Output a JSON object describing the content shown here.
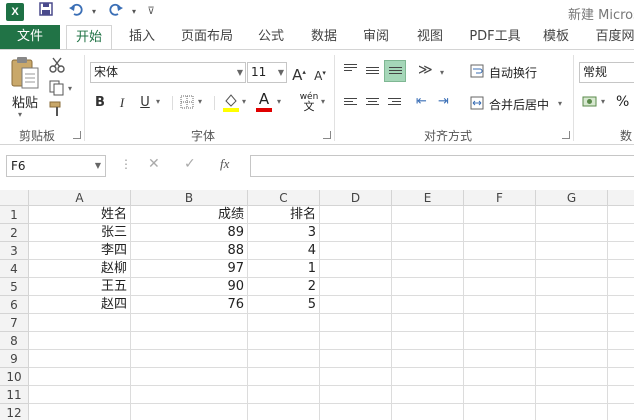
{
  "titlebar": {
    "app_icon": "X",
    "title": "新建 Micros",
    "quick_access": [
      "save-icon",
      "undo-icon",
      "redo-icon",
      "customize-icon"
    ]
  },
  "tabs": [
    {
      "label": "文件"
    },
    {
      "label": "开始"
    },
    {
      "label": "插入"
    },
    {
      "label": "页面布局"
    },
    {
      "label": "公式"
    },
    {
      "label": "数据"
    },
    {
      "label": "审阅"
    },
    {
      "label": "视图"
    },
    {
      "label": "PDF工具"
    },
    {
      "label": "模板"
    },
    {
      "label": "百度网"
    }
  ],
  "ribbon": {
    "clipboard": {
      "paste_label": "粘贴",
      "group_label": "剪贴板"
    },
    "font": {
      "font_name": "宋体",
      "font_size": "11",
      "bold": "B",
      "italic": "I",
      "underline": "U",
      "grow": "A",
      "shrink": "A",
      "font_color_glyph": "A",
      "phonetic_glyph": "wén",
      "group_label": "字体"
    },
    "alignment": {
      "wrap_label": "自动换行",
      "merge_label": "合并后居中",
      "group_label": "对齐方式"
    },
    "number": {
      "format": "常规",
      "group_label": "数",
      "percent": "%"
    }
  },
  "formula_bar": {
    "name_box": "F6",
    "fx": "fx",
    "formula": ""
  },
  "sheet": {
    "columns": [
      "A",
      "B",
      "C",
      "D",
      "E",
      "F",
      "G"
    ],
    "rows": [
      "1",
      "2",
      "3",
      "4",
      "5",
      "6",
      "7",
      "8",
      "9",
      "10",
      "11",
      "12"
    ],
    "cells": [
      [
        "姓名",
        "成绩",
        "排名"
      ],
      [
        "张三",
        "89",
        "3"
      ],
      [
        "李四",
        "88",
        "4"
      ],
      [
        "赵柳",
        "97",
        "1"
      ],
      [
        "王五",
        "90",
        "2"
      ],
      [
        "赵四",
        "76",
        "5"
      ]
    ]
  },
  "colors": {
    "accent": "#217346",
    "highlight": "#a5d6b8"
  }
}
